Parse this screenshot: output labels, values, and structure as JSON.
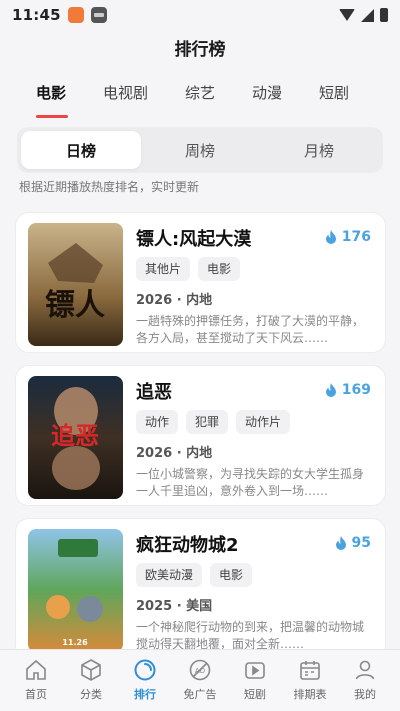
{
  "status_bar": {
    "time": "11:45"
  },
  "header": {
    "title": "排行榜"
  },
  "category_tabs": [
    {
      "label": "电影",
      "active": true
    },
    {
      "label": "电视剧",
      "active": false
    },
    {
      "label": "综艺",
      "active": false
    },
    {
      "label": "动漫",
      "active": false
    },
    {
      "label": "短剧",
      "active": false
    }
  ],
  "period_tabs": [
    {
      "label": "日榜",
      "active": true
    },
    {
      "label": "周榜",
      "active": false
    },
    {
      "label": "月榜",
      "active": false
    }
  ],
  "hint": "根据近期播放热度排名，实时更新",
  "movies": [
    {
      "title": "镖人:风起大漠",
      "heat": "176",
      "tags": [
        "其他片",
        "电影"
      ],
      "meta": "2026 · 内地",
      "desc": "一趟特殊的押镖任务，打破了大漠的平静，各方入局，甚至搅动了天下风云……",
      "poster_text": "镖人"
    },
    {
      "title": "追恶",
      "heat": "169",
      "tags": [
        "动作",
        "犯罪",
        "动作片"
      ],
      "meta": "2026 · 内地",
      "desc": "一位小城警察，为寻找失踪的女大学生孤身一人千里追凶，意外卷入到一场……",
      "poster_text": "追恶"
    },
    {
      "title": "疯狂动物城2",
      "heat": "95",
      "tags": [
        "欧美动漫",
        "电影"
      ],
      "meta": "2025 · 美国",
      "desc": "一个神秘爬行动物的到来，把温馨的动物城搅动得天翻地覆，面对全新……",
      "poster_text": "11.26"
    }
  ],
  "bottom_nav": [
    {
      "label": "首页",
      "icon": "home-icon",
      "active": false
    },
    {
      "label": "分类",
      "icon": "cube-icon",
      "active": false
    },
    {
      "label": "排行",
      "icon": "ranking-icon",
      "active": true
    },
    {
      "label": "免广告",
      "icon": "no-ads-icon",
      "active": false
    },
    {
      "label": "短剧",
      "icon": "short-drama-icon",
      "active": false
    },
    {
      "label": "排期表",
      "icon": "calendar-icon",
      "active": false
    },
    {
      "label": "我的",
      "icon": "profile-icon",
      "active": false
    }
  ],
  "colors": {
    "accent": "#2e8fd6",
    "tab_underline": "#ef4444",
    "heat": "#4aa3df"
  }
}
